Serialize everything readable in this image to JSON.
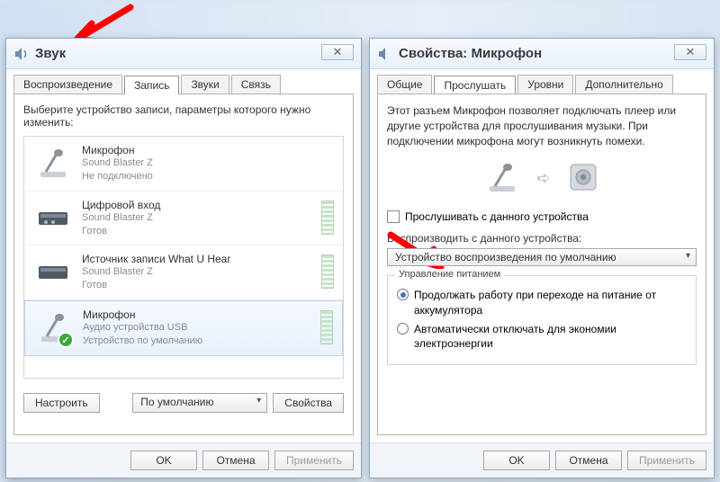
{
  "left": {
    "title": "Звук",
    "tabs": [
      "Воспроизведение",
      "Запись",
      "Звуки",
      "Связь"
    ],
    "active_tab": 1,
    "instruction": "Выберите устройство записи, параметры которого нужно изменить:",
    "devices": [
      {
        "name": "Микрофон",
        "sub1": "Sound Blaster Z",
        "sub2": "Не подключено"
      },
      {
        "name": "Цифровой вход",
        "sub1": "Sound Blaster Z",
        "sub2": "Готов"
      },
      {
        "name": "Источник записи What U Hear",
        "sub1": "Sound Blaster Z",
        "sub2": "Готов"
      },
      {
        "name": "Микрофон",
        "sub1": "Аудио устройства USB",
        "sub2": "Устройство по умолчанию"
      }
    ],
    "configure_btn": "Настроить",
    "default_dd": "По умолчанию",
    "properties_btn": "Свойства",
    "ok": "OK",
    "cancel": "Отмена",
    "apply": "Применить"
  },
  "right": {
    "title": "Свойства: Микрофон",
    "tabs": [
      "Общие",
      "Прослушать",
      "Уровни",
      "Дополнительно"
    ],
    "active_tab": 1,
    "desc": "Этот разъем Микрофон позволяет подключать плеер или другие устройства для прослушивания музыки. При подключении микрофона могут возникнуть помехи.",
    "listen_chk": "Прослушивать с данного устройства",
    "playthrough_label": "Воспроизводить с данного устройства:",
    "playthrough_value": "Устройство воспроизведения по умолчанию",
    "power_legend": "Управление питанием",
    "radio1": "Продолжать работу при переходе на питание от аккумулятора",
    "radio2": "Автоматически отключать для экономии электроэнергии",
    "ok": "OK",
    "cancel": "Отмена",
    "apply": "Применить"
  }
}
